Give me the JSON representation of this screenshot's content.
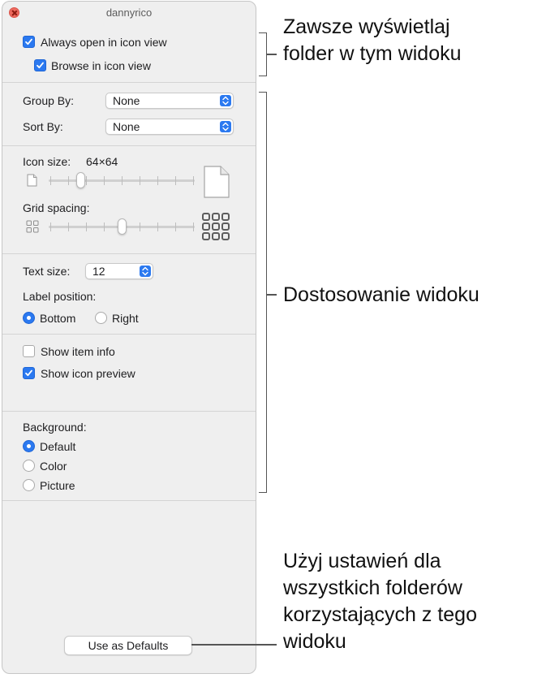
{
  "window": {
    "title": "dannyrico"
  },
  "options": {
    "always_open_label": "Always open in icon view",
    "always_open_checked": true,
    "browse_label": "Browse in icon view",
    "browse_checked": true
  },
  "grouping": {
    "group_by_label": "Group By:",
    "group_by_value": "None",
    "sort_by_label": "Sort By:",
    "sort_by_value": "None"
  },
  "sizing": {
    "icon_size_label": "Icon size:",
    "icon_size_value": "64×64",
    "icon_size_level": 0.2,
    "grid_spacing_label": "Grid spacing:",
    "grid_spacing_level": 0.5,
    "small-icon": "small-document-icon",
    "large-icon": "large-document-icon",
    "grid-small-icon": "small-grid-icon",
    "grid-large-icon": "large-grid-icon"
  },
  "text": {
    "text_size_label": "Text size:",
    "text_size_value": "12",
    "label_position_label": "Label position:",
    "bottom_label": "Bottom",
    "right_label": "Right",
    "selected_position": "Bottom"
  },
  "info": {
    "show_item_info_label": "Show item info",
    "show_item_info_checked": false,
    "show_icon_preview_label": "Show icon preview",
    "show_icon_preview_checked": true
  },
  "background": {
    "label": "Background:",
    "default_label": "Default",
    "color_label": "Color",
    "picture_label": "Picture",
    "selected": "Default"
  },
  "footer": {
    "defaults_button_label": "Use as Defaults"
  },
  "callouts": {
    "top_line1": "Zawsze wyświetlaj",
    "top_line2": "folder w tym widoku",
    "middle": "Dostosowanie widoku",
    "bottom_line1": "Użyj ustawień dla",
    "bottom_line2": "wszystkich folderów",
    "bottom_line3": "korzystających z tego",
    "bottom_line4": "widoku"
  },
  "colors": {
    "accent": "#2b79f0",
    "window_bg": "#efefef",
    "close_button": "#ed6a5e"
  }
}
